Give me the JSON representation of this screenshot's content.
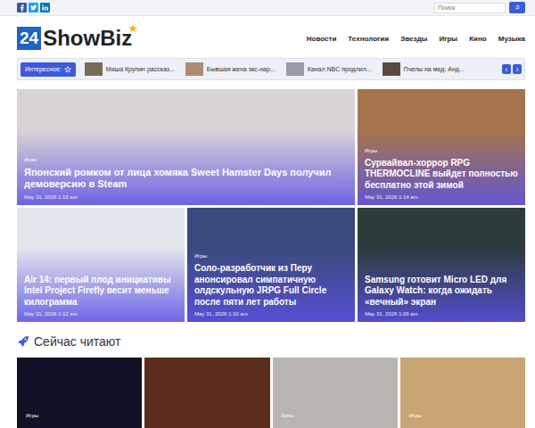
{
  "search": {
    "placeholder": "Поиск",
    "button": "⌕"
  },
  "logo": {
    "number": "24",
    "name": "ShowBiz"
  },
  "nav": [
    "Новости",
    "Технологии",
    "Звезды",
    "Игры",
    "Кино",
    "Музыка"
  ],
  "ticker": {
    "label": "Интересное:",
    "prev": "‹",
    "next": "›",
    "items": [
      {
        "text": "Миша Крупин рассказ...",
        "color": "#7a6a5a"
      },
      {
        "text": "Бывшая жена экс-нар...",
        "color": "#b08a70"
      },
      {
        "text": "Канал NBC продлил...",
        "color": "#9a9aa8"
      },
      {
        "text": "Пчелы на мед: Анд...",
        "color": "#5a4a40"
      }
    ]
  },
  "featured": [
    {
      "category": "Игры",
      "title": "Японский ромком от лица хомяка Sweet Hamster Days получил демоверсию в Steam",
      "date": "May 31, 2026 1:18 am",
      "color": "#d9d4d8"
    },
    {
      "category": "Игры",
      "title": "Сурвайвал-хоррор RPG THERMOCLINE выйдет полностью бесплатно этой зимой",
      "date": "May 31, 2026 1:14 am",
      "color": "#a5744c"
    },
    {
      "category": "",
      "title": "Air 14: первый плод инициативы Intel Project Firefly весит меньше килограмма",
      "date": "May 31, 2026 1:12 am",
      "color": "#e2e6ec"
    },
    {
      "category": "Игры",
      "title": "Соло-разработчик из Перу анонсировал симпатичную олдскульную JRPG Full Circle после пяти лет работы",
      "date": "May 31, 2026 1:10 am",
      "color": "#3b4a7c"
    },
    {
      "category": "",
      "title": "Samsung готовит Micro LED для Galaxy Watch: когда ожидать «вечный» экран",
      "date": "May 31, 2026 1:09 am",
      "color": "#2c3c3c"
    }
  ],
  "section": {
    "title": "Сейчас читают"
  },
  "reading": [
    {
      "category": "Игры",
      "color": "#121226"
    },
    {
      "category": "",
      "color": "#5a2c1c"
    },
    {
      "category": "Кино",
      "color": "#b9b6b2"
    },
    {
      "category": "Игры",
      "color": "#c9a474"
    }
  ]
}
